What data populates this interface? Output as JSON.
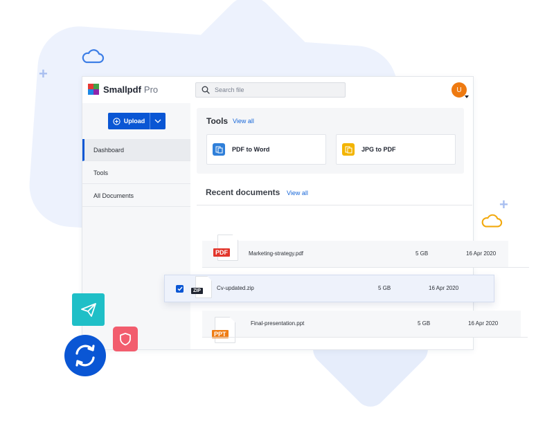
{
  "app": {
    "name": "Smallpdf",
    "plan": "Pro"
  },
  "search": {
    "placeholder": "Search file"
  },
  "user": {
    "initial": "U"
  },
  "sidebar": {
    "upload_label": "Upload",
    "items": [
      {
        "label": "Dashboard",
        "active": true
      },
      {
        "label": "Tools",
        "active": false
      },
      {
        "label": "All Documents",
        "active": false
      }
    ]
  },
  "tools": {
    "title": "Tools",
    "view_all": "View all",
    "items": [
      {
        "label": "PDF to Word",
        "icon": "pdf-to-word-icon",
        "color": "#2f7fd9"
      },
      {
        "label": "JPG to PDF",
        "icon": "jpg-to-pdf-icon",
        "color": "#f3b400"
      }
    ]
  },
  "recent": {
    "title": "Recent documents",
    "view_all": "View all",
    "documents": [
      {
        "name": "Marketing-strategy.pdf",
        "size": "5 GB",
        "date": "16 Apr 2020",
        "type": "PDF",
        "color": "#e2362c",
        "selected": false
      },
      {
        "name": "Cv-updated.zip",
        "size": "5 GB",
        "date": "16 Apr 2020",
        "type": "ZIP",
        "color": "#1f2430",
        "selected": true
      },
      {
        "name": "Final-presentation.ppt",
        "size": "5 GB",
        "date": "16 Apr 2020",
        "type": "PPT",
        "color": "#ef7d14",
        "selected": false
      }
    ]
  },
  "colors": {
    "primary": "#0a56d4",
    "avatar": "#ee7a11",
    "send_tile": "#1fbfc7",
    "shield_tile": "#f25d6e",
    "sync_circle": "#0a56d4"
  }
}
